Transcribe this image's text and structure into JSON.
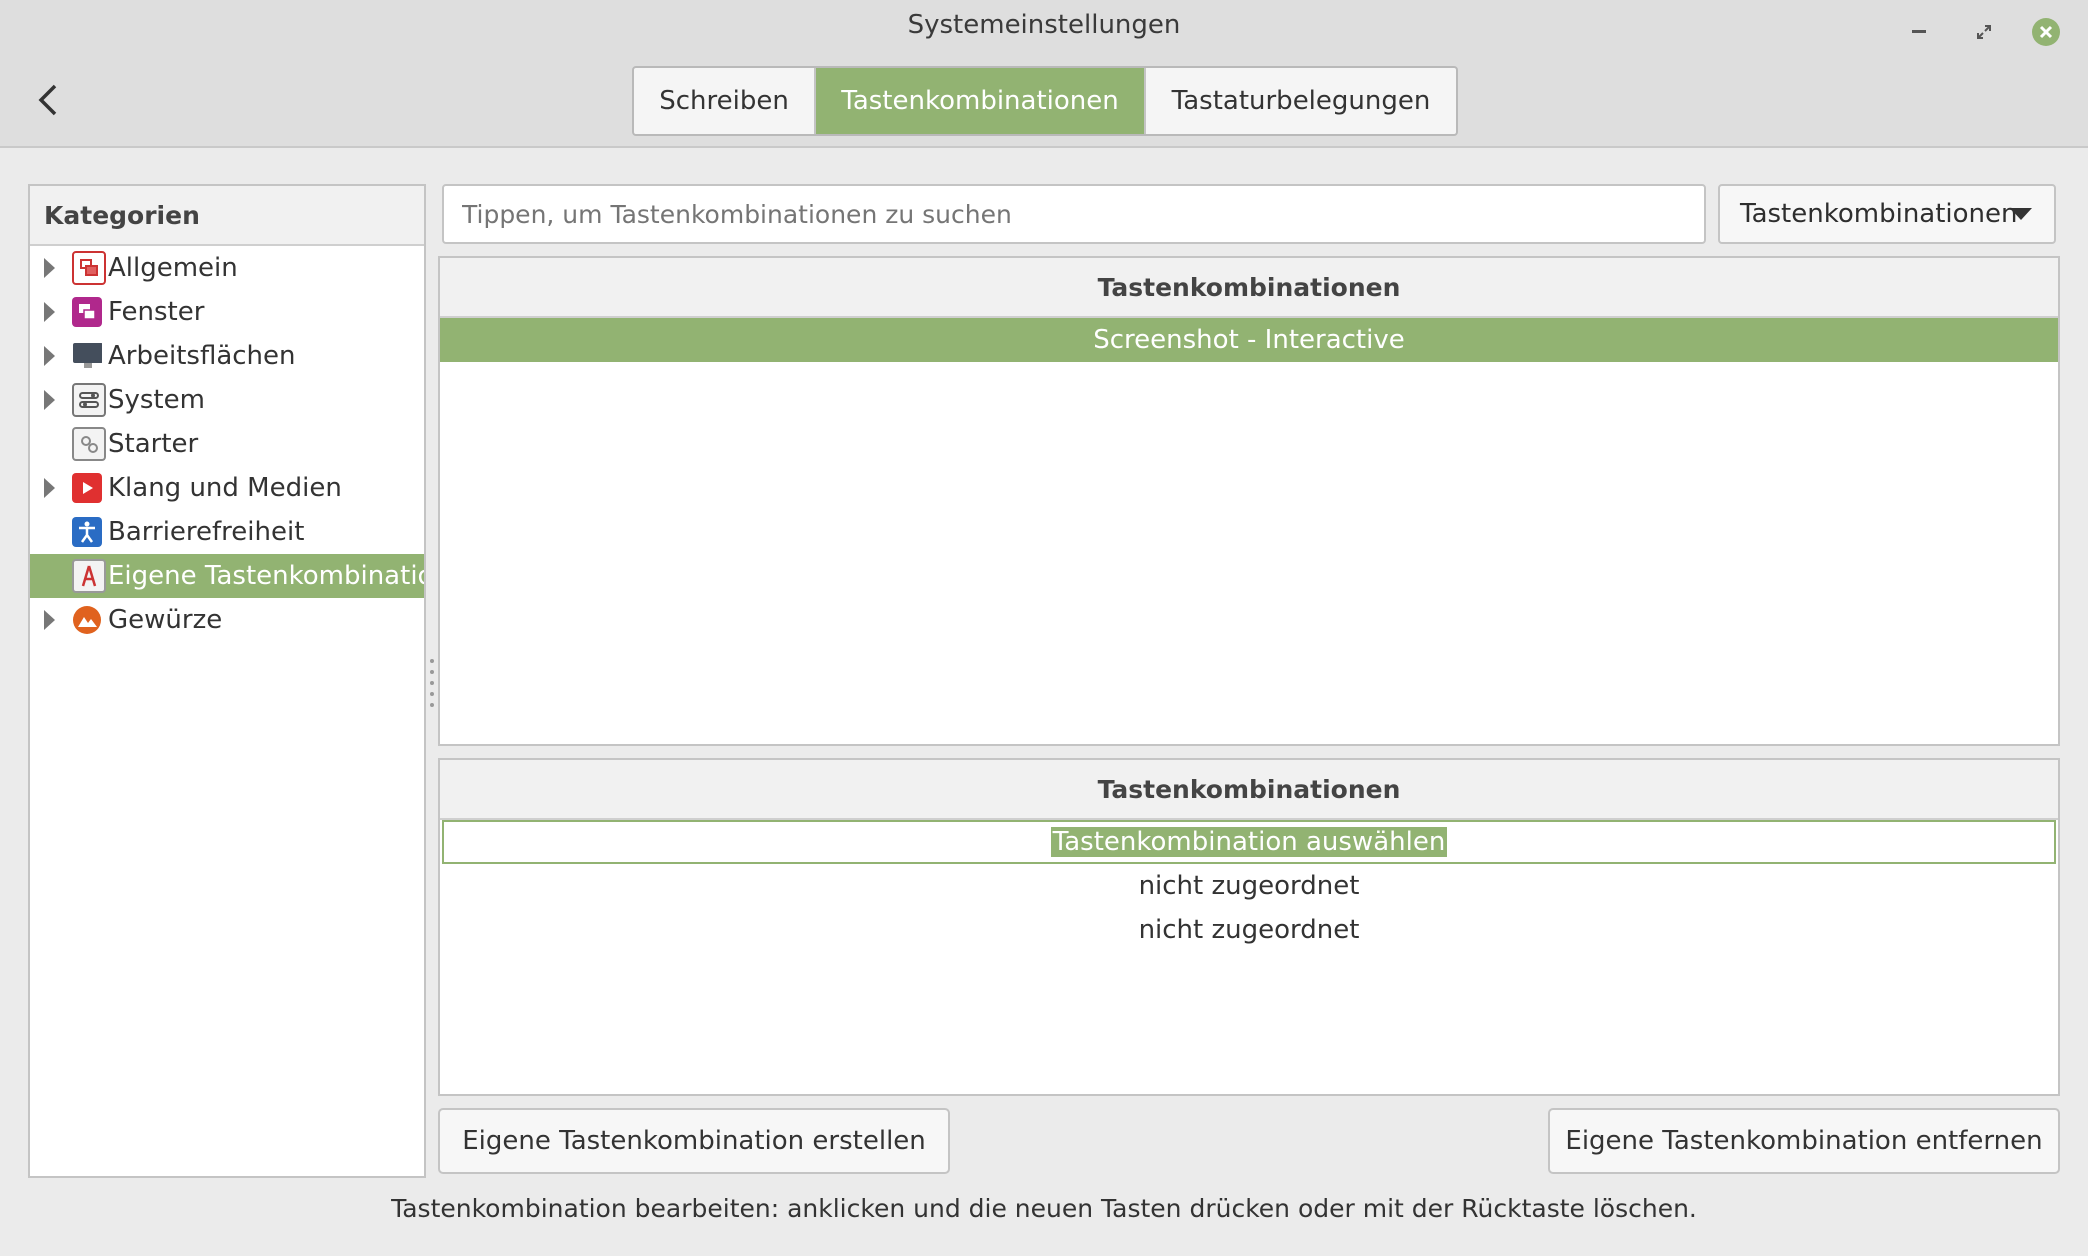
{
  "window": {
    "title": "Systemeinstellungen",
    "controls": [
      "minimize-icon",
      "restore-icon",
      "close-icon"
    ],
    "accent_color": "#92b372"
  },
  "tabs": [
    {
      "label": "Schreiben",
      "active": false
    },
    {
      "label": "Tastenkombinationen",
      "active": true
    },
    {
      "label": "Tastaturbelegungen",
      "active": false
    }
  ],
  "sidebar": {
    "header": "Kategorien",
    "items": [
      {
        "label": "Allgemein",
        "icon": "general-icon",
        "expandable": true,
        "selected": false
      },
      {
        "label": "Fenster",
        "icon": "window-icon",
        "expandable": true,
        "selected": false
      },
      {
        "label": "Arbeitsflächen",
        "icon": "workspace-icon",
        "expandable": true,
        "selected": false
      },
      {
        "label": "System",
        "icon": "system-icon",
        "expandable": true,
        "selected": false
      },
      {
        "label": "Starter",
        "icon": "launcher-icon",
        "expandable": false,
        "selected": false
      },
      {
        "label": "Klang und Medien",
        "icon": "media-icon",
        "expandable": true,
        "selected": false
      },
      {
        "label": "Barrierefreiheit",
        "icon": "accessibility-icon",
        "expandable": false,
        "selected": false
      },
      {
        "label": "Eigene Tastenkombination",
        "icon": "custom-shortcut-icon",
        "expandable": false,
        "selected": true
      },
      {
        "label": "Gewürze",
        "icon": "spices-icon",
        "expandable": true,
        "selected": false
      }
    ]
  },
  "search": {
    "placeholder": "Tippen, um Tastenkombinationen zu suchen",
    "value": ""
  },
  "filter_dropdown": {
    "selected": "Tastenkombinationen"
  },
  "shortcuts_list": {
    "header": "Tastenkombinationen",
    "items": [
      "Screenshot - Interactive"
    ]
  },
  "bindings_list": {
    "header": "Tastenkombinationen",
    "items": [
      "Tastenkombination auswählen",
      "nicht zugeordnet",
      "nicht zugeordnet"
    ]
  },
  "buttons": {
    "add": "Eigene Tastenkombination erstellen",
    "remove": "Eigene Tastenkombination entfernen"
  },
  "hint": "Tastenkombination bearbeiten: anklicken und die neuen Tasten drücken oder mit der Rücktaste löschen."
}
